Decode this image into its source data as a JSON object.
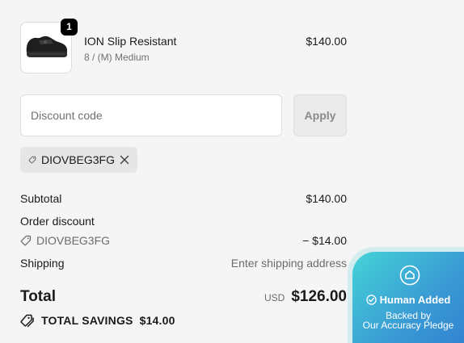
{
  "product": {
    "quantity": "1",
    "name": "ION Slip Resistant",
    "variant": "8 / (M) Medium",
    "price": "$140.00"
  },
  "discount": {
    "placeholder": "Discount code",
    "apply_label": "Apply",
    "applied_code": "DIOVBEG3FG"
  },
  "summary": {
    "subtotal_label": "Subtotal",
    "subtotal_value": "$140.00",
    "order_discount_label": "Order discount",
    "order_discount_code": "DIOVBEG3FG",
    "order_discount_value": "− $14.00",
    "shipping_label": "Shipping",
    "shipping_value": "Enter shipping address",
    "total_label": "Total",
    "total_currency": "USD",
    "total_value": "$126.00",
    "savings_label": "TOTAL SAVINGS",
    "savings_value": "$14.00"
  },
  "badge": {
    "title": "Human Added",
    "line1": "Backed by",
    "line2": "Our Accuracy Pledge"
  },
  "colors": {
    "background": "#f5f5f5",
    "badge_gradient_start": "#45d4d8",
    "badge_gradient_end": "#2f7fd0"
  }
}
